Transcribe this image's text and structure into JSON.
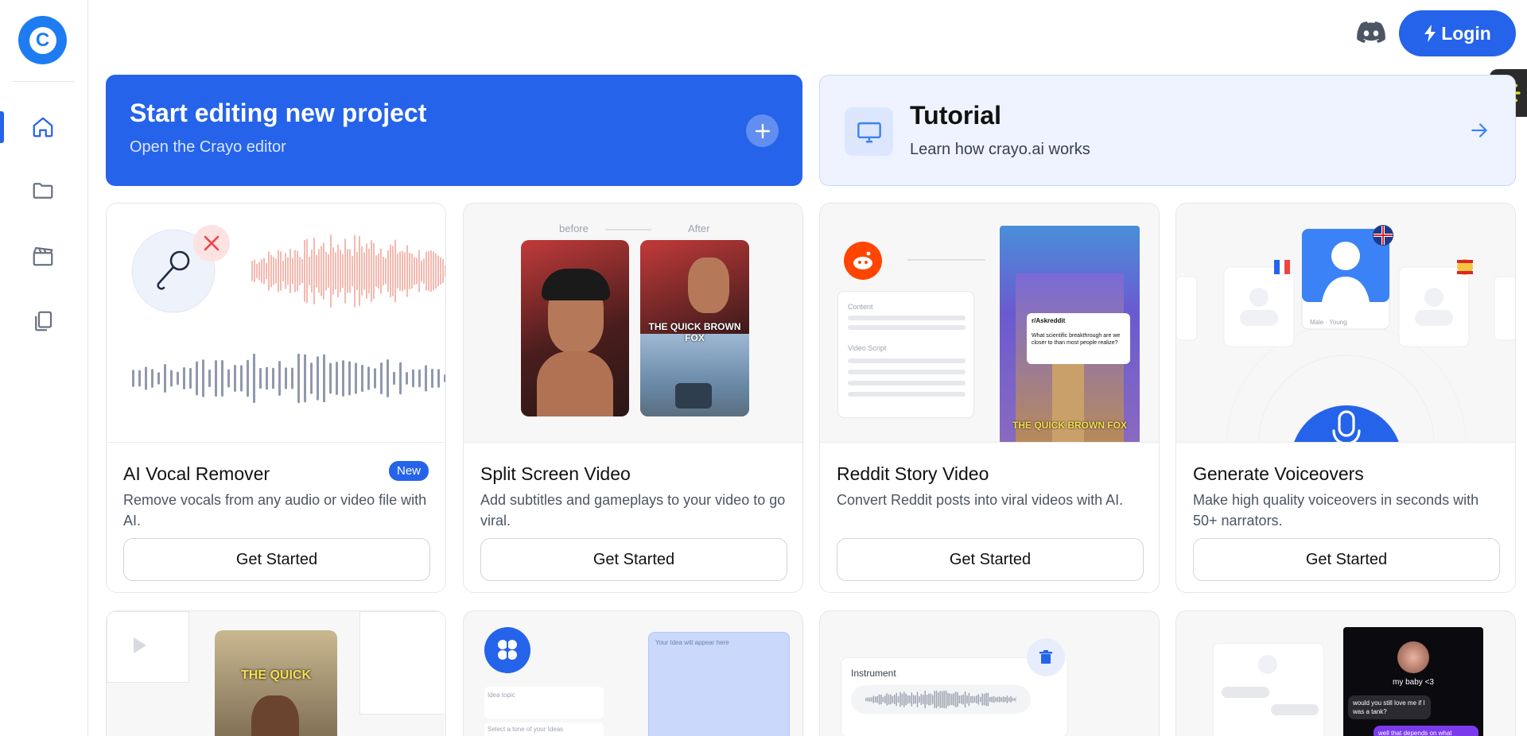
{
  "header": {
    "login_label": "Login"
  },
  "start_card": {
    "title": "Start editing new project",
    "subtitle": "Open the Crayo editor"
  },
  "tutorial_card": {
    "title": "Tutorial",
    "subtitle": "Learn how crayo.ai works"
  },
  "features": [
    {
      "title": "AI Vocal Remover",
      "description": "Remove vocals from any audio or video file with AI.",
      "badge": "New",
      "button": "Get Started"
    },
    {
      "title": "Split Screen Video",
      "description": "Add subtitles and gameplays to your video to go viral.",
      "button": "Get Started",
      "preview_labels": {
        "before": "before",
        "after": "After",
        "caption": "THE QUICK BROWN FOX"
      }
    },
    {
      "title": "Reddit Story Video",
      "description": "Convert Reddit posts into viral videos with AI.",
      "button": "Get Started",
      "preview_labels": {
        "content": "Content",
        "video_script": "Video Script",
        "subreddit": "r/Askreddit",
        "post": "What scientific breakthrough are we closer to than most people realize?",
        "caption": "THE QUICK BROWN FOX"
      }
    },
    {
      "title": "Generate Voiceovers",
      "description": "Make high quality voiceovers in seconds with 50+ narrators.",
      "button": "Get Started",
      "preview_labels": {
        "voice": "Male · Young"
      }
    }
  ],
  "bottom_previews": {
    "card1_caption": "THE QUICK",
    "card2_topic": "Idea topic",
    "card2_tone": "Select a tone of your Ideas",
    "card2_placeholder": "Your Idea will appear here",
    "card3_instrument": "Instrument",
    "card4_name": "my baby <3",
    "card4_msg1": "would you still love me if I was a tank?",
    "card4_msg2": "well that depends on what"
  },
  "colors": {
    "accent": "#2563eb",
    "sidebar_icon": "#6b7280",
    "active_icon": "#2563eb"
  },
  "icons": {
    "logo": "crayo-logo-icon",
    "nav": [
      "home-icon",
      "folder-icon",
      "clapperboard-icon",
      "copy-icon"
    ],
    "discord": "discord-icon",
    "lightning": "lightning-icon",
    "plus": "plus-icon",
    "monitor": "monitor-icon",
    "arrow": "arrow-right-icon"
  }
}
